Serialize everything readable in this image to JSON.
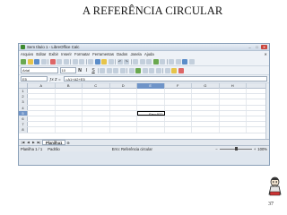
{
  "slide": {
    "title": "A REFERÊNCIA CIRCULAR",
    "page_number": "37"
  },
  "window": {
    "title": "Sem título 1 - LibreOffice Calc"
  },
  "menu": [
    "Arquivo",
    "Editar",
    "Exibir",
    "Inserir",
    "Formatar",
    "Ferramentas",
    "Dados",
    "Janela",
    "Ajuda"
  ],
  "format": {
    "font_name": "Arial",
    "font_size": "10"
  },
  "formula": {
    "cell_ref": "E5",
    "content": "=A1+A2+E5"
  },
  "columns": [
    "A",
    "B",
    "C",
    "D",
    "E",
    "F",
    "G",
    "H"
  ],
  "rows": [
    "1",
    "2",
    "3",
    "4",
    "5",
    "6",
    "7",
    "8"
  ],
  "active": {
    "column": "E",
    "row": "5",
    "cell_value": "Erro:522"
  },
  "sheet": {
    "tab_label": "Planilha1"
  },
  "status": {
    "sheet_position": "Planilha 1 / 1",
    "style": "Padrão",
    "message": "Erro: Referência circular",
    "zoom": "100%"
  }
}
